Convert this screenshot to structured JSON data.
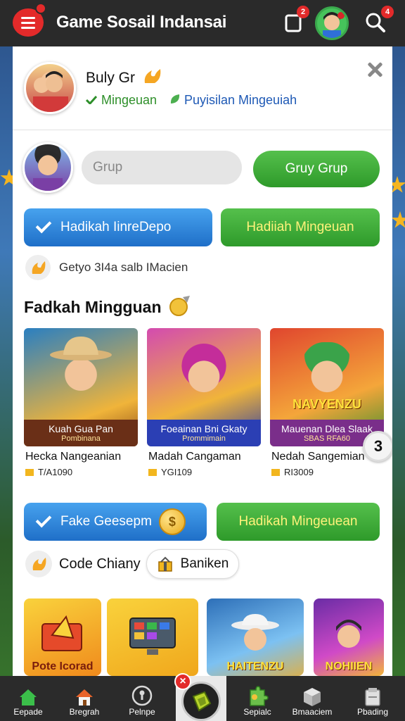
{
  "app": {
    "title": "Game Sosail Indansai"
  },
  "topbar": {
    "notifications_badge": "2",
    "search_badge": "4"
  },
  "profile": {
    "name": "Buly Gr",
    "tag1": "Mingeuan",
    "tag2": "Puyisilan Mingeuiah"
  },
  "join": {
    "input_placeholder": "Grup",
    "join_button": "Gruy Grup"
  },
  "actions1": {
    "blue_button": "Hadikah IinreDepo",
    "green_button": "Hadiiah Mingeuan"
  },
  "info": {
    "text": "Getyo 3I4a salb IMacien"
  },
  "section": {
    "title": "Fadkah Mingguan"
  },
  "cards": [
    {
      "band_title": "Kuah Gua Pan",
      "band_sub": "Pombinana",
      "name": "Hecka Nangeanian",
      "value": "T/A1090"
    },
    {
      "band_title": "Foeainan Bni Gkaty",
      "band_sub": "Prommimain",
      "name": "Madah Cangaman",
      "value": "YGI109"
    },
    {
      "overlay": "NAVYENZU",
      "band_title": "Mauenan Dlea Slaak",
      "band_sub": "SBAS RFA60",
      "name": "Nedah Sangemian",
      "value": "RI3009"
    }
  ],
  "coin_badge": "3",
  "actions2": {
    "blue_button": "Fake Geesepm",
    "coin_symbol": "$",
    "green_button": "Hadikah Mingeuean"
  },
  "code": {
    "label": "Code Chiany",
    "chip_label": "Baniken"
  },
  "tiles": [
    {
      "label": "Pote Icorad"
    },
    {
      "label": ""
    },
    {
      "label": "HAITENZU"
    },
    {
      "label": "NOHIIEN"
    }
  ],
  "bottom_nav": {
    "items": [
      {
        "label": "Eepade"
      },
      {
        "label": "Bregrah"
      },
      {
        "label": "Pelnpe"
      },
      {
        "label": "Sepialc"
      },
      {
        "label": "Bmaaciem"
      },
      {
        "label": "Pbading"
      }
    ],
    "center_close": "×"
  },
  "colors": {
    "accent_red": "#e32a2a",
    "button_green": "#2e9a2a",
    "button_blue": "#1f6fc8",
    "tag_green": "#2e8f2a",
    "tag_blue": "#1e59b5"
  }
}
